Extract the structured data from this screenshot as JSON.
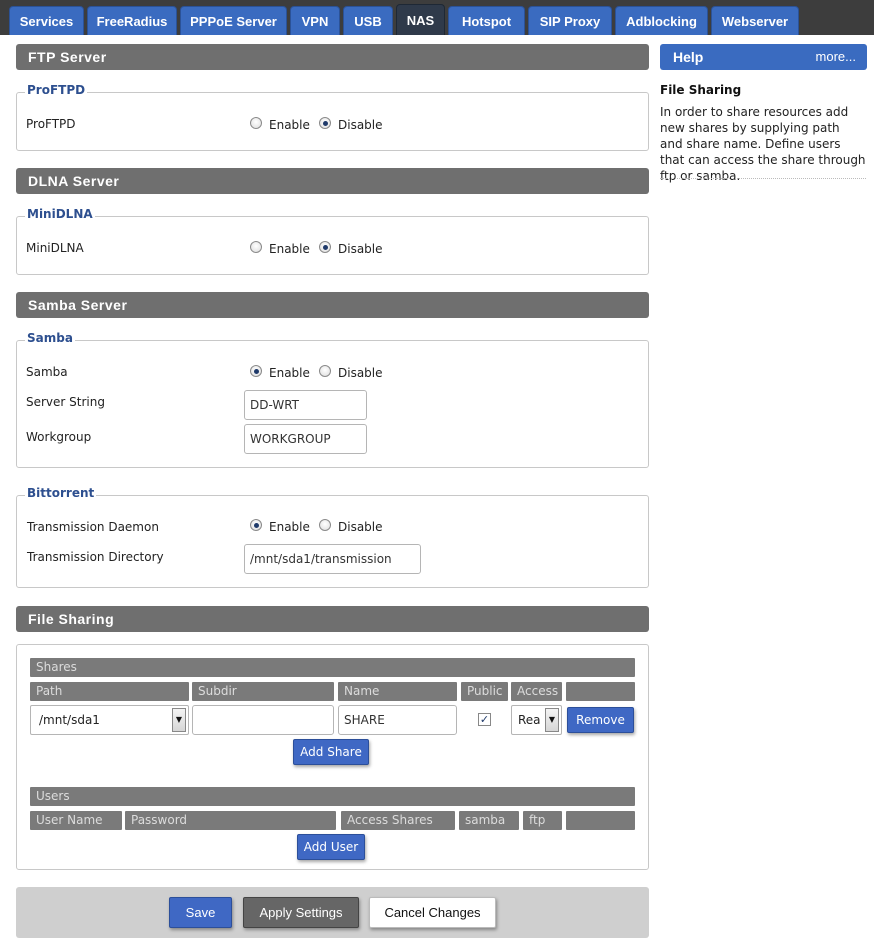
{
  "tabs": [
    {
      "label": "Services",
      "active": false
    },
    {
      "label": "FreeRadius",
      "active": false
    },
    {
      "label": "PPPoE Server",
      "active": false
    },
    {
      "label": "VPN",
      "active": false
    },
    {
      "label": "USB",
      "active": false
    },
    {
      "label": "NAS",
      "active": true
    },
    {
      "label": "Hotspot",
      "active": false
    },
    {
      "label": "SIP Proxy",
      "active": false
    },
    {
      "label": "Adblocking",
      "active": false
    },
    {
      "label": "Webserver",
      "active": false
    }
  ],
  "ftp": {
    "header": "FTP Server",
    "legend": "ProFTPD",
    "row_label": "ProFTPD",
    "enable_label": "Enable",
    "disable_label": "Disable",
    "selected": "Disable"
  },
  "dlna": {
    "header": "DLNA Server",
    "legend": "MiniDLNA",
    "row_label": "MiniDLNA",
    "enable_label": "Enable",
    "disable_label": "Disable",
    "selected": "Disable"
  },
  "samba": {
    "header": "Samba Server",
    "legend": "Samba",
    "row_label": "Samba",
    "enable_label": "Enable",
    "disable_label": "Disable",
    "selected": "Enable",
    "server_string_label": "Server String",
    "server_string_value": "DD-WRT",
    "workgroup_label": "Workgroup",
    "workgroup_value": "WORKGROUP"
  },
  "bittorrent": {
    "legend": "Bittorrent",
    "daemon_label": "Transmission Daemon",
    "enable_label": "Enable",
    "disable_label": "Disable",
    "selected": "Enable",
    "directory_label": "Transmission Directory",
    "directory_value": "/mnt/sda1/transmission"
  },
  "file_sharing": {
    "header": "File Sharing",
    "shares_title": "Shares",
    "share_columns": [
      "Path",
      "Subdir",
      "Name",
      "Public",
      "Access"
    ],
    "share_row": {
      "path": "/mnt/sda1",
      "subdir": "",
      "name": "SHARE",
      "public": true,
      "access": "Rea"
    },
    "remove_label": "Remove",
    "add_share_label": "Add Share",
    "users_title": "Users",
    "user_columns": [
      "User Name",
      "Password",
      "Access Shares",
      "samba",
      "ftp"
    ],
    "add_user_label": "Add User"
  },
  "actions": {
    "save": "Save",
    "apply": "Apply Settings",
    "cancel": "Cancel Changes"
  },
  "help": {
    "header": "Help",
    "more": "more...",
    "title": "File Sharing",
    "text": "In order to share resources add new shares by supplying path and share name. Define users that can access the share through ftp or samba."
  },
  "colors": {
    "tab_blue": "#3a6bc0",
    "tab_active": "#2f3a4a",
    "section_header": "#6f6f6f",
    "legend_blue": "#2d4f8f",
    "button_blue": "#3f68c4"
  }
}
